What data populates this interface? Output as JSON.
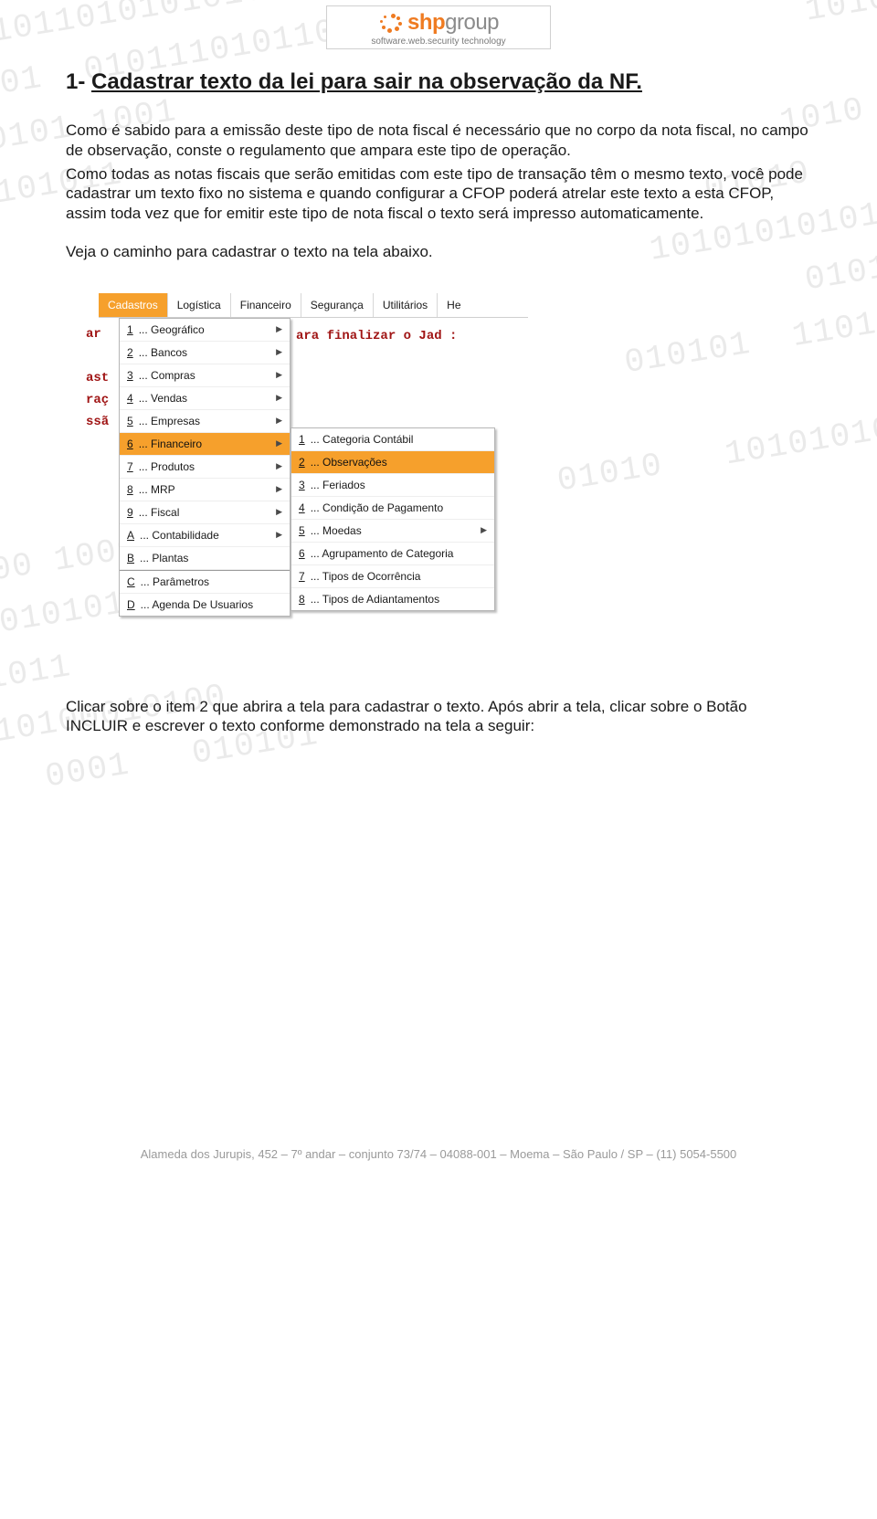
{
  "logo": {
    "brand_orange": "shp",
    "brand_grey": "group",
    "tagline": "software.web.security technology"
  },
  "heading": {
    "prefix": "1- ",
    "title": "Cadastrar texto da lei  para sair na observação da NF."
  },
  "paragraphs": {
    "p1": "Como é sabido para a emissão deste tipo de nota fiscal é necessário que no corpo da nota fiscal, no campo de observação, conste o regulamento que ampara este tipo de operação.",
    "p2": "Como todas as notas fiscais que serão emitidas com este tipo de transação têm o mesmo texto, você pode cadastrar um texto fixo no sistema e quando configurar a CFOP poderá atrelar este texto a esta CFOP, assim toda vez que for emitir este tipo de nota fiscal o texto será impresso automaticamente.",
    "p3": "Veja o caminho para cadastrar o texto na tela abaixo.",
    "p4": "Clicar sobre o item 2 que abrira a tela para cadastrar o texto. Após abrir a tela, clicar sobre o Botão INCLUIR e escrever o texto conforme demonstrado na tela a seguir:"
  },
  "menubar": {
    "items": [
      "Cadastros",
      "Logística",
      "Financeiro",
      "Segurança",
      "Utilitários",
      "He"
    ]
  },
  "sidelabels": [
    "ar",
    "",
    "ast",
    "raç",
    "ssã"
  ],
  "hint": "ara finalizar o Jad :",
  "dd1": {
    "items": [
      {
        "key": "1",
        "label": "... Geográfico",
        "chevron": true
      },
      {
        "key": "2",
        "label": "... Bancos",
        "chevron": true
      },
      {
        "key": "3",
        "label": "... Compras",
        "chevron": true
      },
      {
        "key": "4",
        "label": "... Vendas",
        "chevron": true
      },
      {
        "key": "5",
        "label": "... Empresas",
        "chevron": true
      },
      {
        "key": "6",
        "label": "... Financeiro",
        "chevron": true,
        "hi": true
      },
      {
        "key": "7",
        "label": "... Produtos",
        "chevron": true
      },
      {
        "key": "8",
        "label": "... MRP",
        "chevron": true
      },
      {
        "key": "9",
        "label": "... Fiscal",
        "chevron": true
      },
      {
        "key": "A",
        "label": "... Contabilidade",
        "chevron": true
      },
      {
        "key": "B",
        "label": "... Plantas",
        "chevron": false
      },
      {
        "key": "C",
        "label": "... Parâmetros",
        "chevron": false,
        "sep": true
      },
      {
        "key": "D",
        "label": "... Agenda De Usuarios",
        "chevron": false
      }
    ]
  },
  "dd2": {
    "items": [
      {
        "key": "1",
        "label": "... Categoria Contábil",
        "chevron": false
      },
      {
        "key": "2",
        "label": "... Observações",
        "chevron": false,
        "hi": true
      },
      {
        "key": "3",
        "label": "... Feriados",
        "chevron": false
      },
      {
        "key": "4",
        "label": "... Condição de Pagamento",
        "chevron": false
      },
      {
        "key": "5",
        "label": "... Moedas",
        "chevron": true
      },
      {
        "key": "6",
        "label": "... Agrupamento de Categoria",
        "chevron": false
      },
      {
        "key": "7",
        "label": "... Tipos de Ocorrência",
        "chevron": false
      },
      {
        "key": "8",
        "label": "... Tipos de Adiantamentos",
        "chevron": false
      }
    ]
  },
  "footer": "Alameda dos Jurupis, 452 – 7º andar – conjunto 73/74 – 04088-001 – Moema – São Paulo / SP – (11) 5054-5500"
}
